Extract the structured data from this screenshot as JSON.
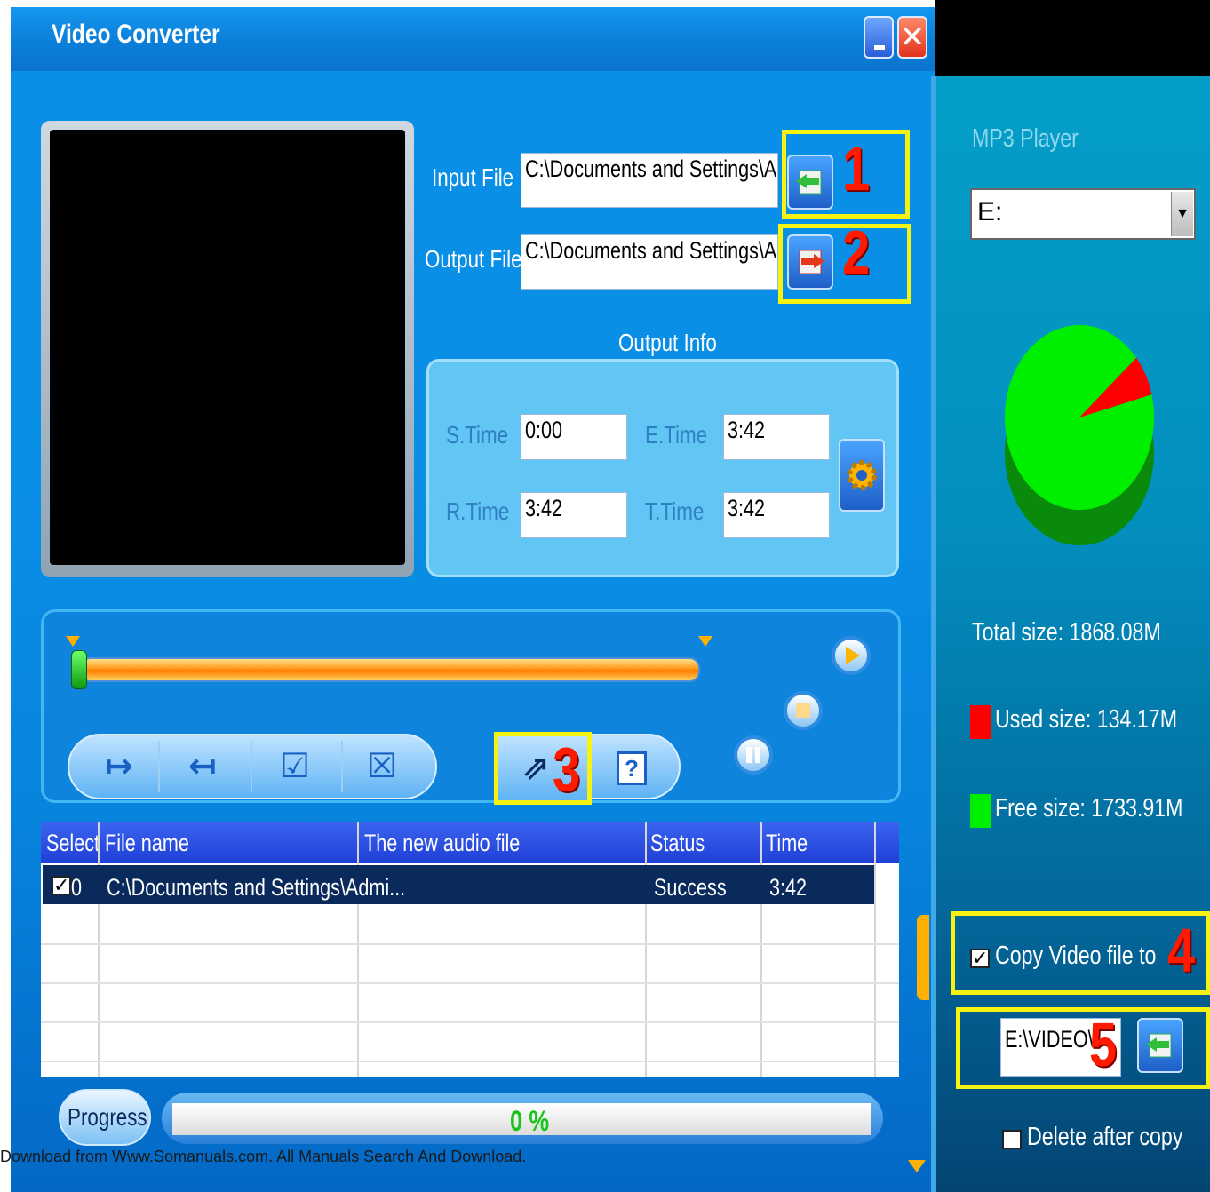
{
  "window": {
    "title": "Video Converter",
    "minimize_glyph": "_",
    "close_glyph": "✕"
  },
  "files": {
    "input_label": "Input File",
    "input_value": "C:\\Documents and Settings\\Administ",
    "output_label": "Output File",
    "output_value": "C:\\Documents and Settings\\Administ"
  },
  "output_info": {
    "title": "Output Info",
    "s_time_label": "S.Time",
    "s_time_value": "0:00",
    "e_time_label": "E.Time",
    "e_time_value": "3:42",
    "r_time_label": "R.Time",
    "r_time_value": "3:42",
    "t_time_label": "T.Time",
    "t_time_value": "3:42"
  },
  "controls": {
    "set_start_glyph": "↦",
    "set_end_glyph": "↤",
    "check_glyph": "☑",
    "uncheck_glyph": "☒",
    "convert_glyph": "⇗",
    "help_glyph": "?"
  },
  "table": {
    "headers": [
      "Select",
      "File name",
      "The new audio file",
      "Status",
      "Time"
    ],
    "rows": [
      {
        "select": "0",
        "file_name": "C:\\Documents and Settings\\Admi...",
        "new_audio_file": "",
        "status": "Success",
        "time": "3:42"
      }
    ]
  },
  "progress": {
    "label": "Progress",
    "percent_text": "0 %",
    "value": 0
  },
  "annotations": [
    "1",
    "2",
    "3",
    "4",
    "5"
  ],
  "right_panel": {
    "device_label": "MP3 Player",
    "drive_value": "E:",
    "total_size": "Total size: 1868.08M",
    "used_size": "Used size: 134.17M",
    "free_size": "Free size: 1733.91M",
    "used_fraction": 0.0718,
    "copy_label": "Copy Video file to",
    "copy_checked": true,
    "copy_path": "E:\\VIDEO\\",
    "delete_label": "Delete after copy",
    "delete_checked": false
  },
  "colors": {
    "used": "#ff0000",
    "free": "#00ee00",
    "highlight": "#f6f312",
    "annotation": "#ff1a00"
  },
  "footer_text": "Download from Www.Somanuals.com. All Manuals Search And Download."
}
